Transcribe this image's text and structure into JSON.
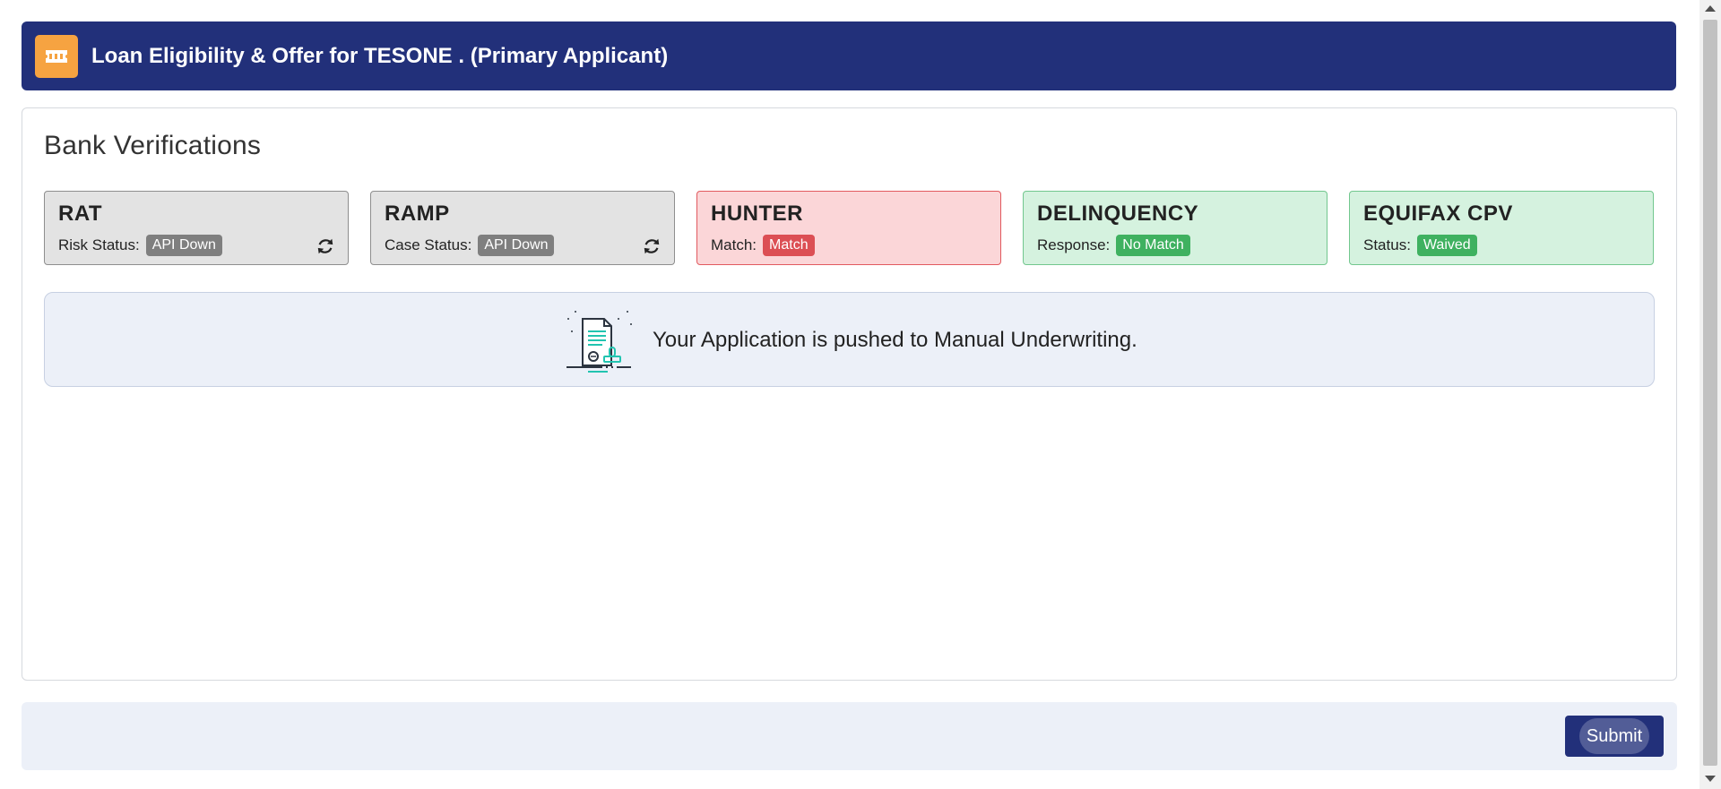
{
  "header": {
    "title": "Loan Eligibility & Offer for TESONE . (Primary Applicant)",
    "icon": "ticket-icon",
    "color": "#22307a",
    "icon_color": "#f6a341"
  },
  "section": {
    "title": "Bank Verifications"
  },
  "verifications": [
    {
      "title": "RAT",
      "label": "Risk Status:",
      "status": "API Down",
      "state": "gray",
      "refresh_icon": "refresh-icon"
    },
    {
      "title": "RAMP",
      "label": "Case Status:",
      "status": "API Down",
      "state": "gray",
      "refresh_icon": "refresh-icon"
    },
    {
      "title": "HUNTER",
      "label": "Match:",
      "status": "Match",
      "state": "red"
    },
    {
      "title": "DELINQUENCY",
      "label": "Response:",
      "status": "No Match",
      "state": "green"
    },
    {
      "title": "EQUIFAX CPV",
      "label": "Status:",
      "status": "Waived",
      "state": "green"
    }
  ],
  "info": {
    "message": "Your Application is pushed to Manual Underwriting.",
    "icon": "document-stamp-icon"
  },
  "footer": {
    "submit_label": "Submit"
  },
  "colors": {
    "gray_badge": "#7f7f7f",
    "red_badge": "#dc4f54",
    "green_badge": "#3fb160"
  }
}
